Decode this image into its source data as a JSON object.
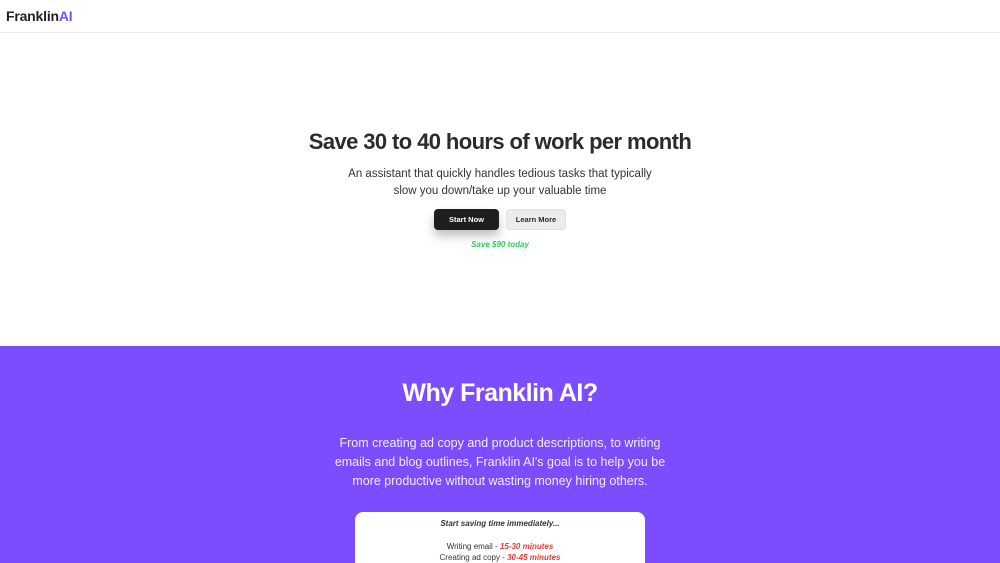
{
  "nav": {
    "logo_main": "Franklin",
    "logo_accent": "AI"
  },
  "hero": {
    "title": "Save 30 to 40 hours of work per month",
    "subtitle": "An assistant that quickly handles tedious tasks that typically slow you down/take up your valuable time",
    "start_button": "Start Now",
    "learn_button": "Learn More",
    "save_note": "Save $90 today"
  },
  "why": {
    "title": "Why Franklin AI?",
    "description": "From creating ad copy and product descriptions, to writing emails and blog outlines, Franklin AI's goal is to help you be more productive without wasting money hiring others.",
    "card": {
      "heading": "Start saving time immediately...",
      "rows": [
        {
          "task": "Writing email - ",
          "time": "15-30 minutes"
        },
        {
          "task": "Creating ad copy - ",
          "time": "30-45 minutes"
        }
      ]
    }
  },
  "colors": {
    "accent": "#7c4dff",
    "save_green": "#2ecc5f",
    "time_red": "#e33b3b",
    "dark_button": "#1e1e21"
  }
}
